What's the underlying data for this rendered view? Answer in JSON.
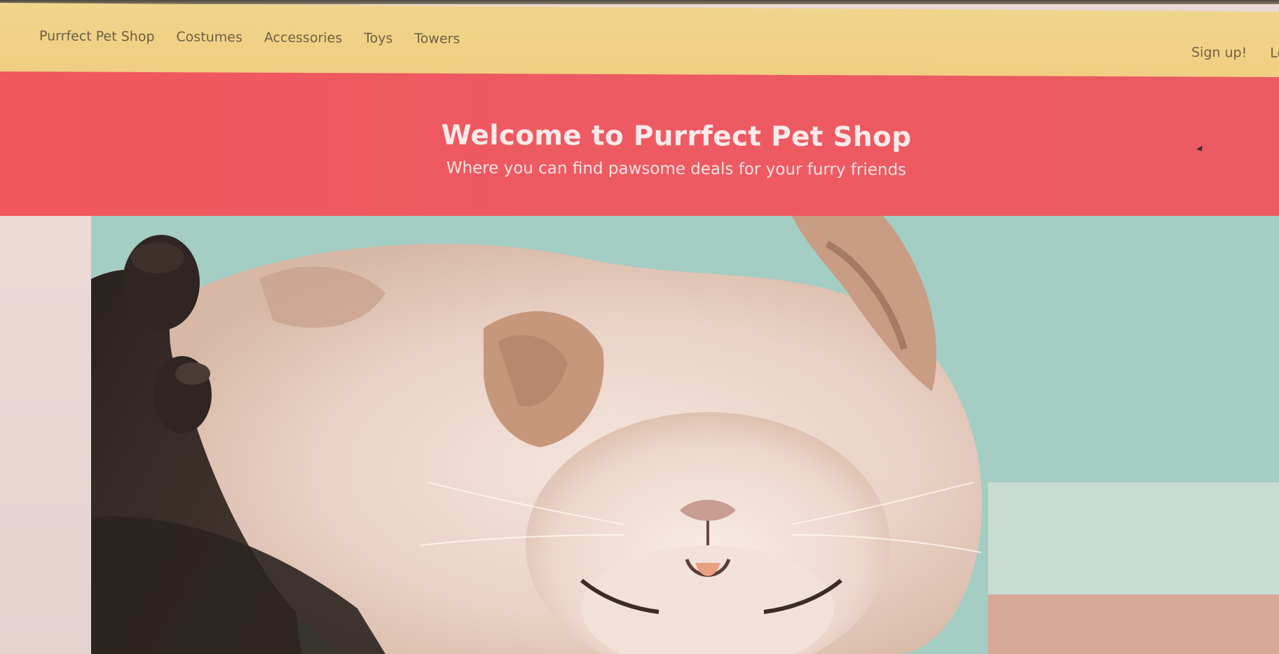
{
  "navbar": {
    "brand": "Purrfect Pet Shop",
    "links": [
      "Costumes",
      "Accessories",
      "Toys",
      "Towers"
    ],
    "right_links": [
      "Sign up!",
      "Lo"
    ]
  },
  "hero": {
    "title": "Welcome to Purrfect Pet Shop",
    "subtitle": "Where you can find pawsome deals for your furry friends"
  },
  "image": {
    "subject": "sleeping-cat-photo"
  },
  "colors": {
    "navbar_bg": "#f1d184",
    "hero_bg": "#ee5a62",
    "nav_text": "#6d6245",
    "hero_text": "#fbeaea"
  }
}
